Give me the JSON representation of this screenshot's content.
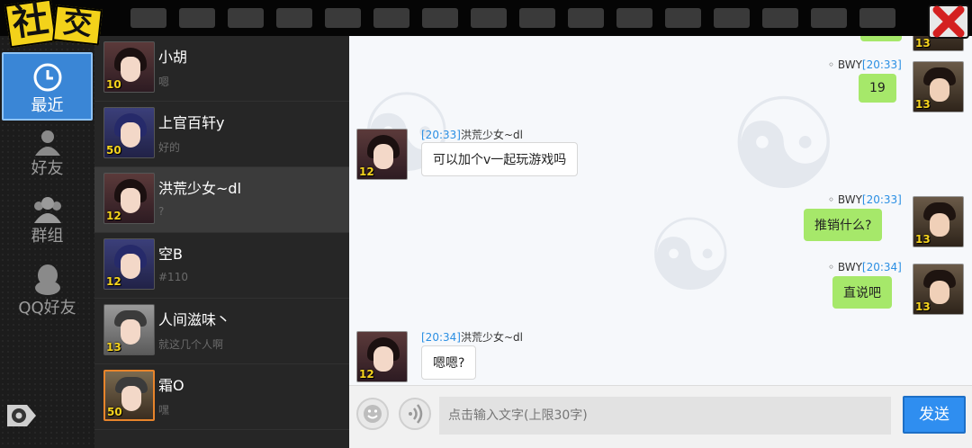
{
  "logo": {
    "char1": "社",
    "char2": "交"
  },
  "nav": {
    "recent": "最近",
    "friends": "好友",
    "groups": "群组",
    "qq_friends": "QQ好友"
  },
  "contacts": [
    {
      "name": "小胡",
      "last_message": "嗯",
      "level": "10",
      "avatar": "girl-avatar"
    },
    {
      "name": "上官百轩y",
      "last_message": "好的",
      "level": "50",
      "avatar": "girl-avatar"
    },
    {
      "name": "洪荒少女~dl",
      "last_message": "?",
      "level": "12",
      "avatar": "girl-avatar",
      "selected": true
    },
    {
      "name": "空B",
      "last_message": "#110",
      "level": "12",
      "avatar": "girl-avatar"
    },
    {
      "name": "人间滋味丶",
      "last_message": "就这几个人啊",
      "level": "13",
      "avatar": "guy-avatar"
    },
    {
      "name": "霜O",
      "last_message": "嘿",
      "level": "50",
      "avatar": "guy-avatar"
    }
  ],
  "messages": [
    {
      "sender": "BWY",
      "time": "[20:33]",
      "text": "19",
      "mine": true,
      "level": "13"
    },
    {
      "sender": "洪荒少女~dl",
      "time": "[20:33]",
      "text": "可以加个v一起玩游戏吗",
      "mine": false,
      "level": "12"
    },
    {
      "sender": "BWY",
      "time": "[20:33]",
      "text": "推销什么?",
      "mine": true,
      "level": "13"
    },
    {
      "sender": "BWY",
      "time": "[20:34]",
      "text": "直说吧",
      "mine": true,
      "level": "13"
    },
    {
      "sender": "洪荒少女~dl",
      "time": "[20:34]",
      "text": "嗯嗯?",
      "mine": false,
      "level": "12"
    }
  ],
  "top_partial_level": "13",
  "input": {
    "placeholder": "点击输入文字(上限30字)"
  },
  "send_label": "发送",
  "colors": {
    "accent": "#2f8ef0",
    "my_bubble": "#a6e86a",
    "time": "#2b8fe3",
    "level": "#f6d41e"
  }
}
